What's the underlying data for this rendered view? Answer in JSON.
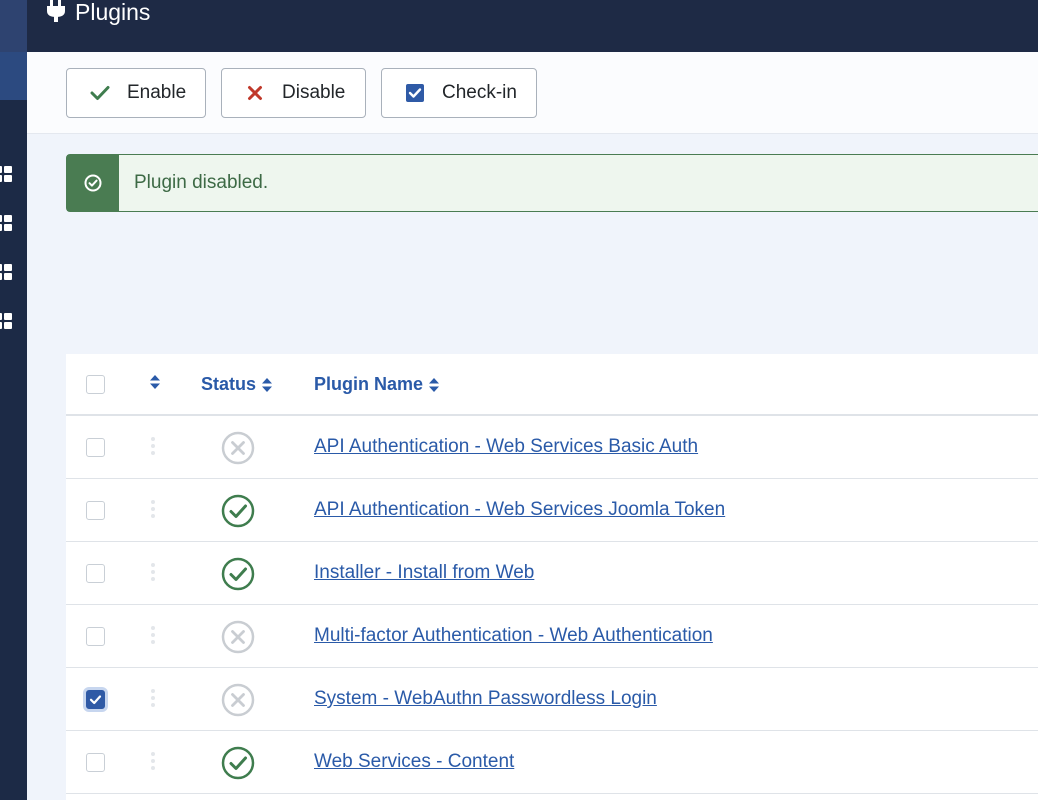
{
  "header": {
    "title": "Plugins",
    "icon": "plug-icon"
  },
  "toolbar": {
    "enable_label": "Enable",
    "disable_label": "Disable",
    "checkin_label": "Check-in"
  },
  "alert": {
    "message": "Plugin disabled.",
    "icon": "check-circle-icon"
  },
  "table": {
    "headers": {
      "status": "Status",
      "name": "Plugin Name"
    },
    "rows": [
      {
        "name": "API Authentication - Web Services Basic Auth",
        "status": "disabled",
        "selected": false
      },
      {
        "name": "API Authentication - Web Services Joomla Token",
        "status": "enabled",
        "selected": false
      },
      {
        "name": "Installer - Install from Web",
        "status": "enabled",
        "selected": false
      },
      {
        "name": "Multi-factor Authentication - Web Authentication",
        "status": "disabled",
        "selected": false
      },
      {
        "name": "System - WebAuthn Passwordless Login",
        "status": "disabled",
        "selected": true
      },
      {
        "name": "Web Services - Content",
        "status": "enabled",
        "selected": false
      }
    ]
  },
  "colors": {
    "accent": "#2a5aa8",
    "success": "#3f7d4e",
    "danger": "#c0392b",
    "header_bg": "#1e2a45",
    "disabled_status": "#c9cdd2"
  }
}
